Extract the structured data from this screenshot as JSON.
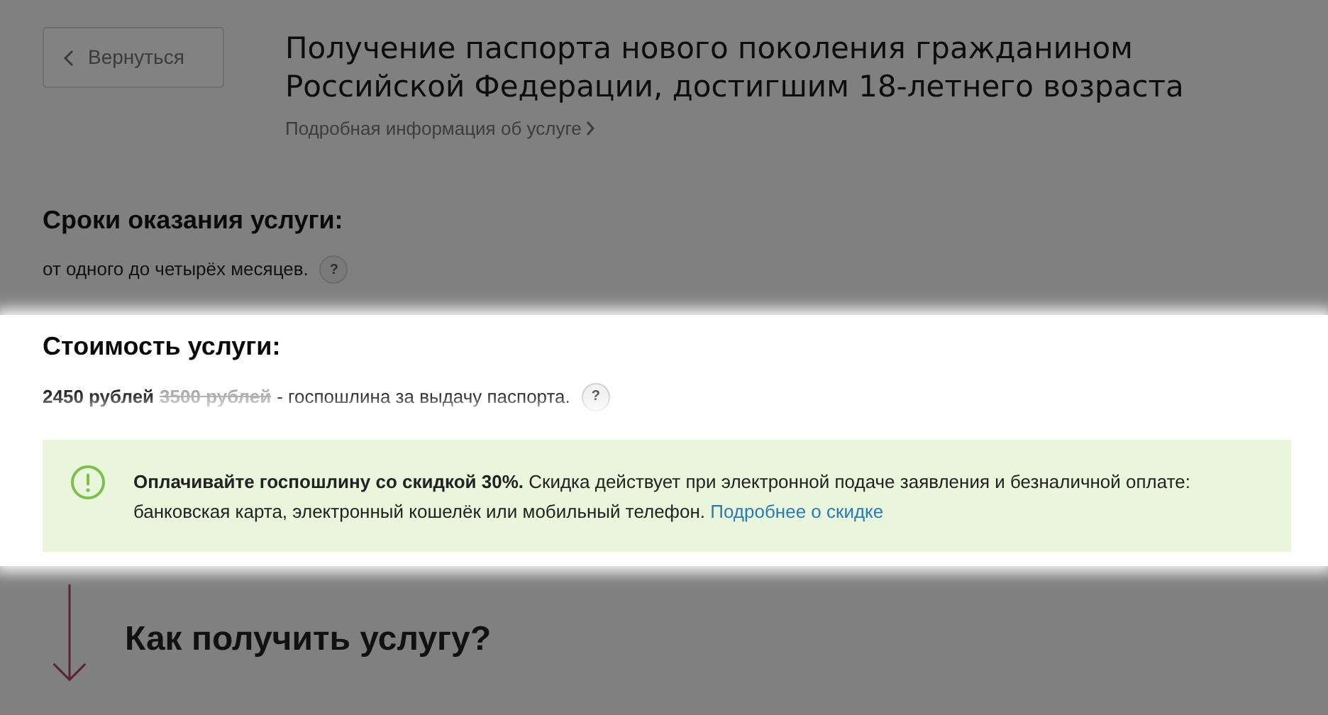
{
  "back_button": {
    "label": "Вернуться"
  },
  "header": {
    "title": "Получение паспорта нового поколения гражданином Российской Федерации, достигшим 18-летнего возраста",
    "details_link": "Подробная информация об услуге"
  },
  "sections": [
    {
      "heading": "Сроки оказания услуги:",
      "text": "от одного до четырёх месяцев.",
      "help": "?",
      "highlighted": false
    },
    {
      "heading": "Стоимость услуги:",
      "price": "2450 рублей",
      "old_price": "3500 рублей",
      "text": "- госпошлина за выдачу паспорта.",
      "help": "?",
      "highlighted": true
    }
  ],
  "alert": {
    "text": "**Оплачивайте госпошлину со скидкой 30%.** Скидка действует при электронной подаче заявления и безналичной оплате: банковская карта, электронный кошелёк или мобильный телефон.",
    "link": "Подробнее о скидке",
    "highlighted": true
  },
  "next_section": {
    "heading": "Как получить услугу?"
  }
}
